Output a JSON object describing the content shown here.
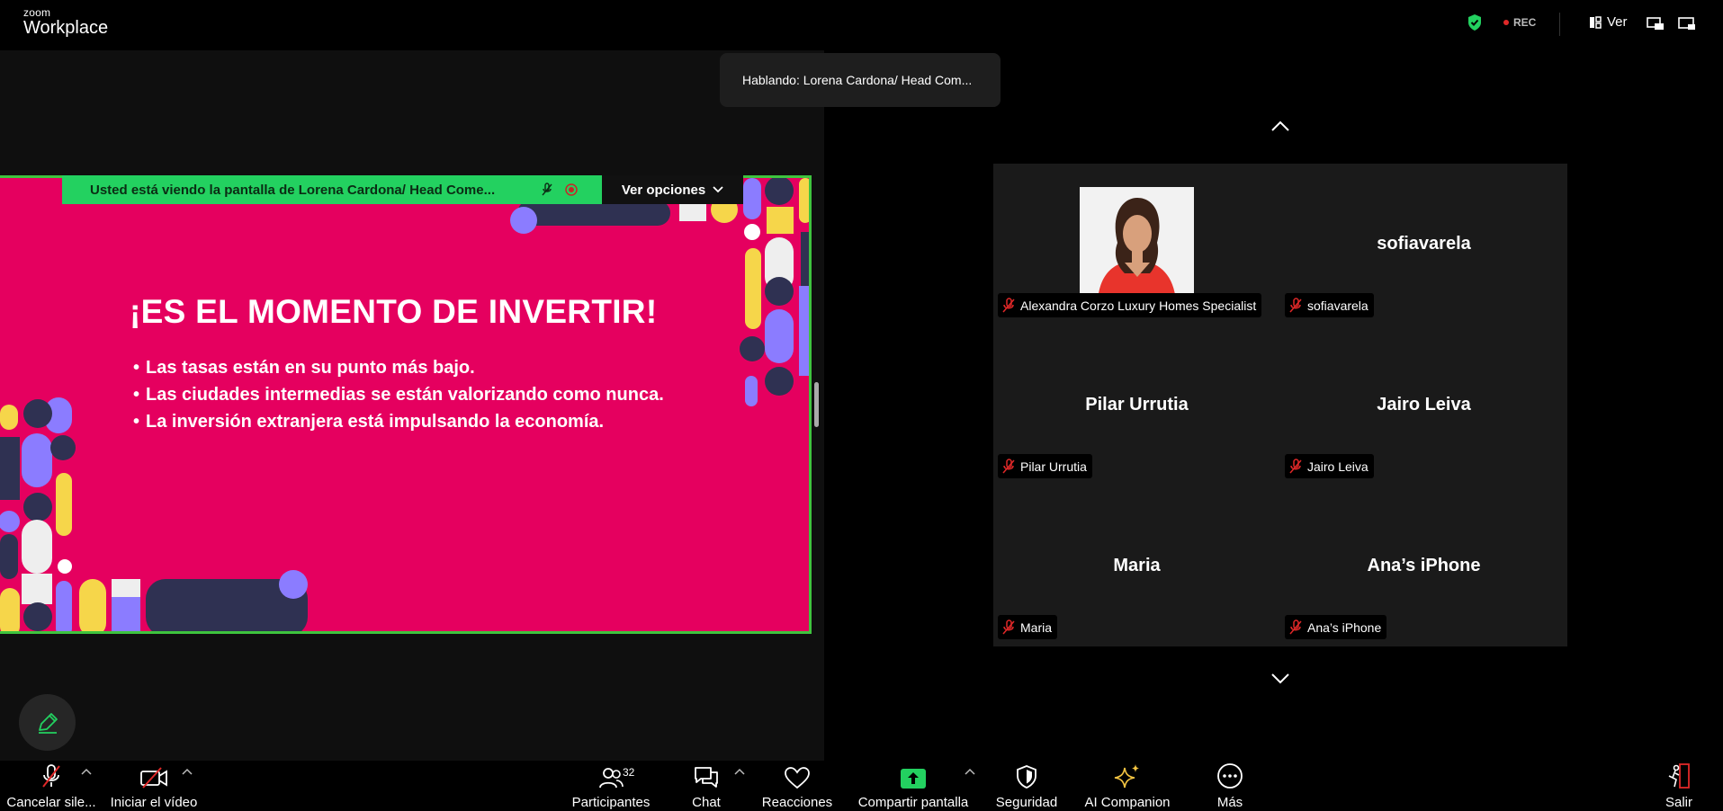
{
  "topbar": {
    "logo_small": "zoom",
    "logo_big": "Workplace",
    "shield_icon": "shield-check-icon",
    "rec_label": "REC",
    "view_label": "Ver"
  },
  "speaking": "Hablando: Lorena Cardona/ Head Com...",
  "share": {
    "viewing_text": "Usted está viendo la pantalla de  Lorena Cardona/ Head Come...",
    "options_label": "Ver opciones",
    "slide_title": "¡ES EL MOMENTO DE INVERTIR!",
    "slide_bullets": [
      "Las tasas están en su punto más bajo.",
      "Las ciudades intermedias se están valorizando como nunca.",
      "La inversión extranjera está impulsando la economía."
    ],
    "slide_color": "#e5005f",
    "frame_color": "#3ec43e"
  },
  "gallery": {
    "tiles": [
      {
        "display": "",
        "name": "Alexandra Corzo Luxury Homes Specialist",
        "muted": true,
        "has_photo": true
      },
      {
        "display": "sofiavarela",
        "name": "sofiavarela",
        "muted": true
      },
      {
        "display": "Pilar Urrutia",
        "name": "Pilar Urrutia",
        "muted": true
      },
      {
        "display": "Jairo Leiva",
        "name": "Jairo Leiva",
        "muted": true
      },
      {
        "display": "Maria",
        "name": "Maria",
        "muted": true
      },
      {
        "display": "Ana’s iPhone",
        "name": "Ana’s iPhone",
        "muted": true
      }
    ]
  },
  "toolbar": {
    "unmute_label": "Cancelar sile...",
    "video_label": "Iniciar el vídeo",
    "participants_label": "Participantes",
    "participants_count": "32",
    "chat_label": "Chat",
    "reactions_label": "Reacciones",
    "share_label": "Compartir pantalla",
    "security_label": "Seguridad",
    "ai_label": "AI Companion",
    "more_label": "Más",
    "leave_label": "Salir"
  },
  "colors": {
    "accent_green": "#23d160",
    "muted_red": "#e02828",
    "ai_gold": "#f5c542"
  }
}
